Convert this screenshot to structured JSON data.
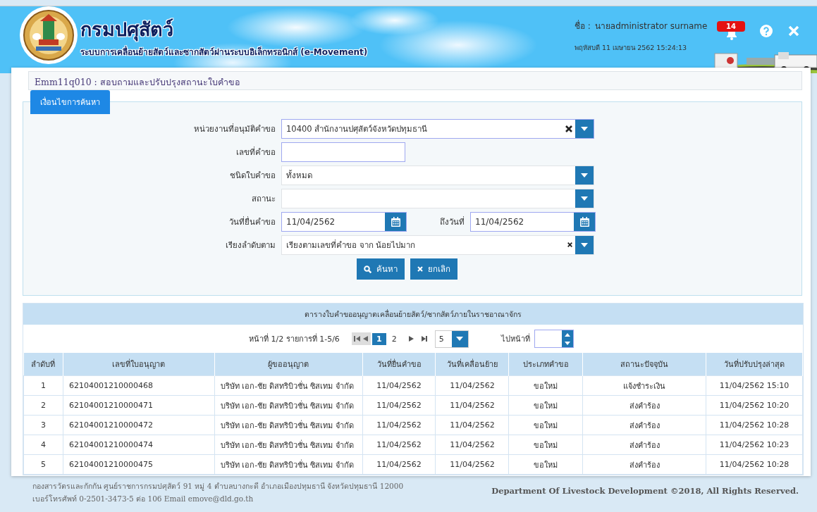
{
  "header": {
    "title": "กรมปศุสัตว์",
    "subtitle": "ระบบการเคลื่อนย้ายสัตว์และซากสัตว์ผ่านระบบอิเล็กทรอนิกส์ (e-Movement)",
    "user_label": "ชื่อ :",
    "user_name": "นายadministrator surname",
    "datetime": "พฤหัสบดี 11 เมษายน 2562 15:24:13",
    "notification_count": "14"
  },
  "page_title": "Emm11q010 : สอบถามและปรับปรุงสถานะใบคำขอ",
  "search": {
    "legend": "เงื่อนไขการค้นหา",
    "fields": [
      {
        "kind": "select",
        "label": "หน่วยงานที่อนุมัติคำขอ",
        "value": "10400 สำนักงานปศุสัตว์จังหวัดปทุมธานี",
        "clearable": true
      },
      {
        "kind": "text",
        "label": "เลขที่คำขอ"
      },
      {
        "kind": "select",
        "label": "ชนิดใบคำขอ",
        "value": "ทั้งหมด",
        "clearable": false
      },
      {
        "kind": "select",
        "label": "สถานะ",
        "clearable": false
      },
      {
        "kind": "daterange",
        "label": "วันที่ยื่นคำขอ",
        "value": "11/04/2562",
        "to_label": "ถึงวันที่",
        "to_value": "11/04/2562"
      },
      {
        "kind": "select",
        "label": "เรียงลำดับตาม",
        "value": "เรียงตามเลขที่คำขอ จาก น้อยไปมาก",
        "clearable": true
      }
    ],
    "buttons": [
      {
        "kind": "search",
        "label": "ค้นหา"
      },
      {
        "kind": "cancel",
        "label": "ยกเลิก"
      }
    ]
  },
  "results": {
    "title": "ตารางใบคำขออนุญาตเคลื่อนย้ายสัตว์/ซากสัตว์ภายในราชอาณาจักร",
    "pager": {
      "info": "หน้าที่ 1/2 รายการที่ 1-5/6",
      "pages": [
        {
          "label": "1",
          "selected": true
        },
        {
          "label": "2",
          "selected": false
        }
      ],
      "page_size": "5",
      "goto_label": "ไปหน้าที่"
    },
    "columns": [
      "ลำดับที่",
      "เลขที่ใบอนุญาต",
      "ผู้ขออนุญาต",
      "วันที่ยื่นคำขอ",
      "วันที่เคลื่อนย้าย",
      "ประเภทคำขอ",
      "สถานะปัจจุบัน",
      "วันที่ปรับปรุงล่าสุด"
    ],
    "rows": [
      [
        "1",
        "62104001210000468",
        "บริษัท เอก-ชัย ดิสทริบิวชั่น ซิสเทม จำกัด",
        "11/04/2562",
        "11/04/2562",
        "ขอใหม่",
        "แจ้งชำระเงิน",
        "11/04/2562 15:10"
      ],
      [
        "2",
        "62104001210000471",
        "บริษัท เอก-ชัย ดิสทริบิวชั่น ซิสเทม จำกัด",
        "11/04/2562",
        "11/04/2562",
        "ขอใหม่",
        "ส่งคำร้อง",
        "11/04/2562 10:20"
      ],
      [
        "3",
        "62104001210000472",
        "บริษัท เอก-ชัย ดิสทริบิวชั่น ซิสเทม จำกัด",
        "11/04/2562",
        "11/04/2562",
        "ขอใหม่",
        "ส่งคำร้อง",
        "11/04/2562 10:28"
      ],
      [
        "4",
        "62104001210000474",
        "บริษัท เอก-ชัย ดิสทริบิวชั่น ซิสเทม จำกัด",
        "11/04/2562",
        "11/04/2562",
        "ขอใหม่",
        "ส่งคำร้อง",
        "11/04/2562 10:23"
      ],
      [
        "5",
        "62104001210000475",
        "บริษัท เอก-ชัย ดิสทริบิวชั่น ซิสเทม จำกัด",
        "11/04/2562",
        "11/04/2562",
        "ขอใหม่",
        "ส่งคำร้อง",
        "11/04/2562 10:28"
      ]
    ]
  },
  "footer": {
    "address": "กองสารวัตรและกักกัน ศูนย์ราชการกรมปศุสัตว์ 91 หมู่ 4 ตำบลบางกะดี อำเภอเมืองปทุมธานี จังหวัดปทุมธานี 12000",
    "contact": "เบอร์โทรศัพท์ 0-2501-3473-5 ต่อ 106 Email emove@dld.go.th",
    "copyright": "Department Of Livestock Development ©2018, All Rights Reserved."
  }
}
